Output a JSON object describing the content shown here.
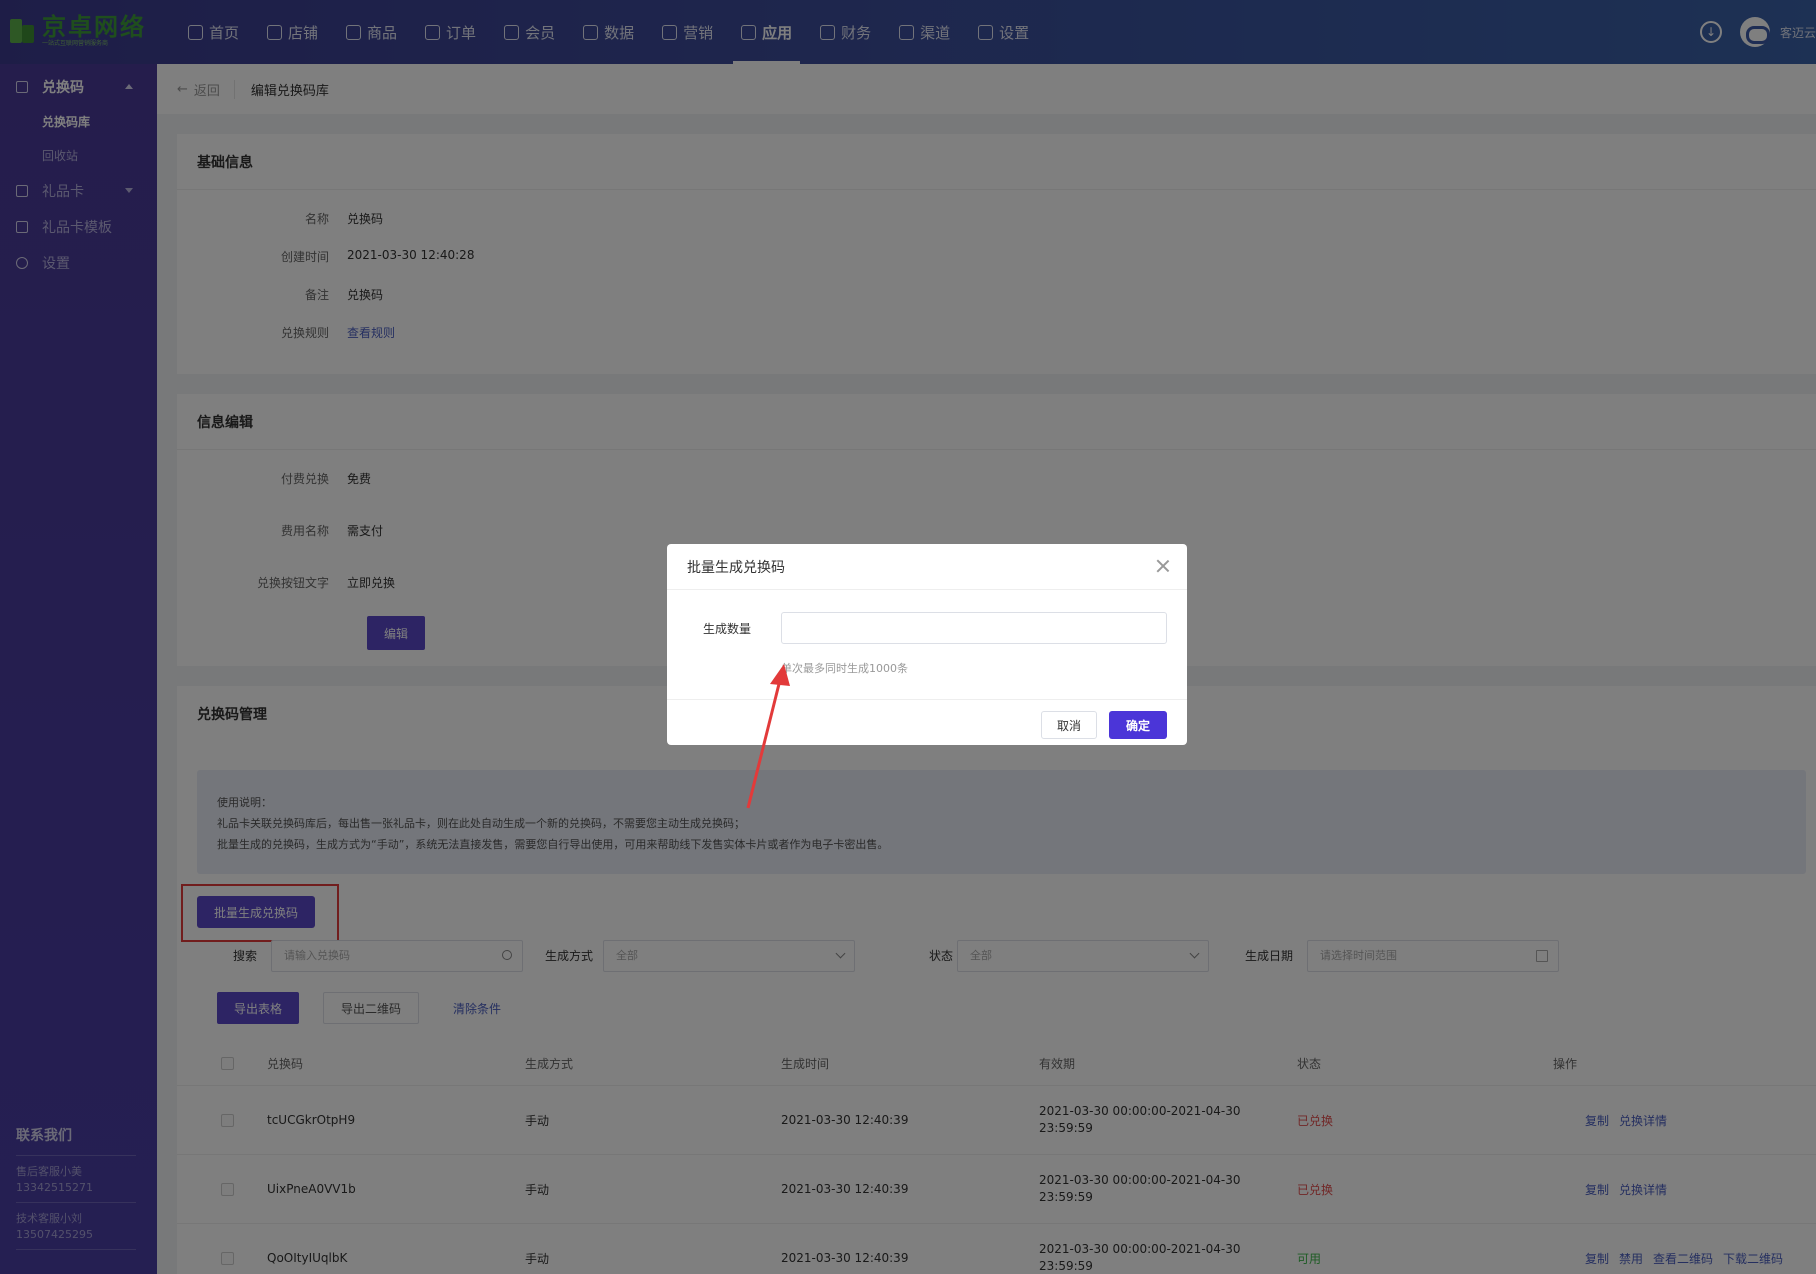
{
  "brand": {
    "name": "京卓网络",
    "tagline": "一站式互联网营销服务商"
  },
  "nav": [
    {
      "label": "首页"
    },
    {
      "label": "店铺"
    },
    {
      "label": "商品"
    },
    {
      "label": "订单"
    },
    {
      "label": "会员"
    },
    {
      "label": "数据"
    },
    {
      "label": "营销"
    },
    {
      "label": "应用"
    },
    {
      "label": "财务"
    },
    {
      "label": "渠道"
    },
    {
      "label": "设置"
    }
  ],
  "nav_active": "应用",
  "user": {
    "name": "客迈云"
  },
  "sidebar": {
    "group_redeem": "兑换码",
    "sub_library": "兑换码库",
    "sub_recycle": "回收站",
    "group_giftcard": "礼品卡",
    "group_template": "礼品卡模板",
    "group_settings": "设置",
    "contact_title": "联系我们",
    "contacts": [
      {
        "name": "售后客服小美",
        "phone": "13342515271"
      },
      {
        "name": "技术客服小刘",
        "phone": "13507425295"
      }
    ]
  },
  "breadcrumb": {
    "back": "返回",
    "title": "编辑兑换码库"
  },
  "basic": {
    "title": "基础信息",
    "name_label": "名称",
    "name_value": "兑换码",
    "created_label": "创建时间",
    "created_value": "2021-03-30 12:40:28",
    "remark_label": "备注",
    "remark_value": "兑换码",
    "rule_label": "兑换规则",
    "rule_value": "查看规则"
  },
  "edit": {
    "title": "信息编辑",
    "paid_label": "付费兑换",
    "paid_value": "免费",
    "fee_label": "费用名称",
    "fee_value": "需支付",
    "btn_text_label": "兑换按钮文字",
    "btn_text_value": "立即兑换",
    "edit_button": "编辑"
  },
  "manage": {
    "title": "兑换码管理",
    "notice": [
      "使用说明：",
      "礼品卡关联兑换码库后，每出售一张礼品卡，则在此处自动生成一个新的兑换码，不需要您主动生成兑换码；",
      "批量生成的兑换码，生成方式为“手动”，系统无法直接发售，需要您自行导出使用，可用来帮助线下发售实体卡片或者作为电子卡密出售。"
    ],
    "batch_button": "批量生成兑换码",
    "filters": {
      "search_label": "搜索",
      "search_placeholder": "请输入兑换码",
      "method_label": "生成方式",
      "method_value": "全部",
      "status_label": "状态",
      "status_value": "全部",
      "date_label": "生成日期",
      "date_placeholder": "请选择时间范围"
    },
    "export_table": "导出表格",
    "export_qr": "导出二维码",
    "clear": "清除条件",
    "columns": [
      "兑换码",
      "生成方式",
      "生成时间",
      "有效期",
      "状态",
      "操作"
    ],
    "rows": [
      {
        "code": "tcUCGkrOtpH9",
        "method": "手动",
        "time": "2021-03-30 12:40:39",
        "validity": "2021-03-30 00:00:00-2021-04-30 23:59:59",
        "status": "已兑换",
        "status_color": "#e24e4e",
        "ops": [
          "复制",
          "兑换详情"
        ]
      },
      {
        "code": "UixPneA0VV1b",
        "method": "手动",
        "time": "2021-03-30 12:40:39",
        "validity": "2021-03-30 00:00:00-2021-04-30 23:59:59",
        "status": "已兑换",
        "status_color": "#e24e4e",
        "ops": [
          "复制",
          "兑换详情"
        ]
      },
      {
        "code": "QoOItyIUqlbK",
        "method": "手动",
        "time": "2021-03-30 12:40:39",
        "validity": "2021-03-30 00:00:00-2021-04-30 23:59:59",
        "status": "可用",
        "status_color": "#3db84a",
        "ops": [
          "复制",
          "禁用",
          "查看二维码",
          "下载二维码"
        ]
      }
    ]
  },
  "dialog": {
    "title": "批量生成兑换码",
    "qty_label": "生成数量",
    "qty_value": "",
    "tip": "单次最多同时生成1000条",
    "cancel": "取消",
    "confirm": "确定"
  },
  "colors": {
    "primary": "#5b48c9",
    "confirm": "#4b35d8",
    "highlight": "#e23a3a",
    "link": "#4a5fc1"
  }
}
